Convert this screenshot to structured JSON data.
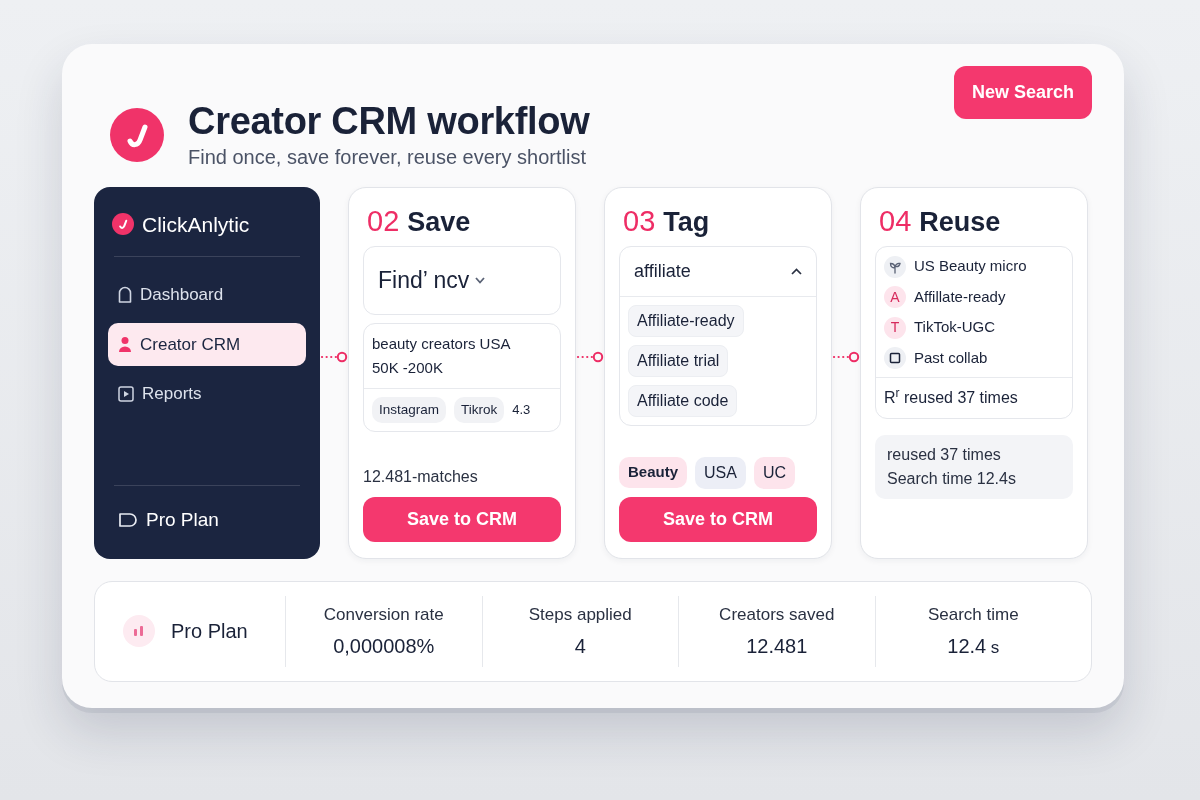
{
  "header": {
    "title": "Creator CRM workflow",
    "subtitle": "Find once, save forever, reuse every shortlist",
    "new_search_button": "New Search"
  },
  "sidebar": {
    "brand": "ClickAnlytic",
    "items": [
      {
        "label": "Dashboard",
        "selected": false
      },
      {
        "label": "Creator CRM",
        "selected": true
      },
      {
        "label": "Reports",
        "selected": false
      }
    ],
    "footer": "Pro Plan"
  },
  "steps": [
    {
      "kind": "save",
      "number": "02",
      "title": "Save",
      "select": {
        "value": "Find’ ncv",
        "expanded": false
      },
      "query": [
        "beauty creators USA",
        "50K -200K"
      ],
      "chips": [
        "Instagram",
        "Tikrok"
      ],
      "trailing_value": "4.3",
      "matches": "12.481-matches",
      "button": "Save to CRM"
    },
    {
      "kind": "tag",
      "number": "03",
      "title": "Tag",
      "dropdown": {
        "value": "affiliate",
        "expanded": true,
        "options": [
          "Affiliate-ready",
          "Affiliate trial",
          "Affiliate code"
        ]
      },
      "tags": [
        {
          "label": "Beauty",
          "color": "#fde4ec",
          "selected": true
        },
        {
          "label": "USA",
          "color": "#eceef6",
          "selected": false
        },
        {
          "label": "UC",
          "color": "#fde4ec",
          "selected": false
        }
      ],
      "button": "Save to CRM"
    },
    {
      "kind": "reuse",
      "number": "04",
      "title": "Reuse",
      "shortlists": [
        {
          "kind": "icon",
          "label": "US Beauty micro"
        },
        {
          "kind": "letter",
          "letter": "A",
          "label": "Affillate-ready"
        },
        {
          "kind": "letter",
          "letter": "T",
          "label": "TikTok-UGC"
        },
        {
          "kind": "icon",
          "label": "Past collab"
        }
      ],
      "list_footer": "R$^{r}$ reused 37 times",
      "summary": [
        "reused 37 times",
        "Search time 12.4s"
      ]
    }
  ],
  "stats_bar": {
    "plan": "Pro Plan",
    "stats": [
      {
        "label": "Conversion rate",
        "value": "0,000008%"
      },
      {
        "label": "Steps applied",
        "value": "4"
      },
      {
        "label": "Creators saved",
        "value": "12.481"
      },
      {
        "label": "Search time",
        "value": "12.4",
        "unit": "s"
      }
    ]
  }
}
